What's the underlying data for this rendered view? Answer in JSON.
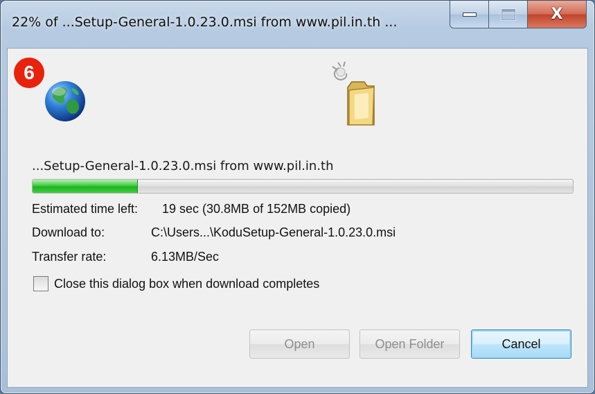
{
  "window": {
    "title": "22% of ...Setup-General-1.0.23.0.msi from www.pil.in.th ...",
    "controls": {
      "minimize": "minimize",
      "maximize": "maximize",
      "close": "X"
    }
  },
  "badge": {
    "number": "6",
    "color": "#e8220c"
  },
  "icons": {
    "source": "globe-icon",
    "destination": "folder-icon"
  },
  "download": {
    "filename": "...Setup-General-1.0.23.0.msi from www.pil.in.th",
    "progress_fraction": 0.195,
    "estimated_label": "Estimated time left:",
    "estimated_value": "19 sec (30.8MB of 152MB copied)",
    "download_to_label": "Download to:",
    "download_to_value": "C:\\Users...\\KoduSetup-General-1.0.23.0.msi",
    "rate_label": "Transfer rate:",
    "rate_value": "6.13MB/Sec"
  },
  "options": {
    "close_when_done_label": "Close this dialog box when download completes",
    "close_when_done_checked": false
  },
  "buttons": {
    "open": "Open",
    "open_folder": "Open Folder",
    "cancel": "Cancel"
  },
  "colors": {
    "progress": "#1fb325",
    "accent": "#3c7fb1"
  }
}
